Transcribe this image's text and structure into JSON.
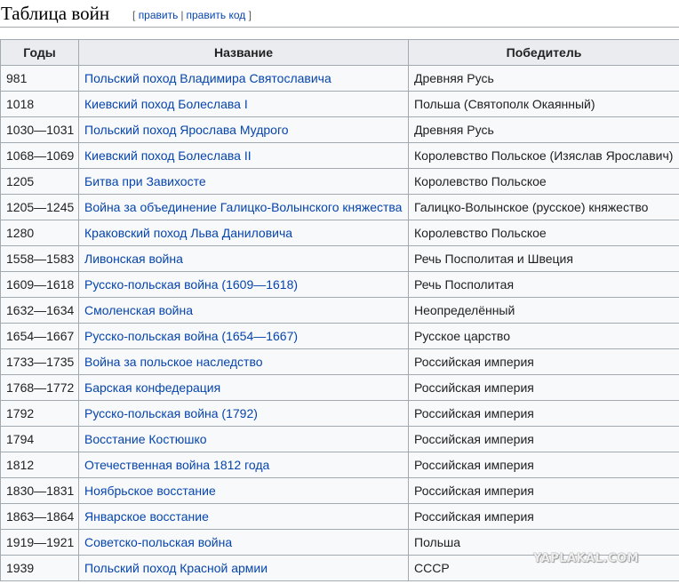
{
  "heading": {
    "title": "Таблица войн",
    "open_bracket": "[",
    "edit_label": "править",
    "separator": "|",
    "edit_code_label": "править код",
    "close_bracket": "]"
  },
  "table": {
    "columns": [
      "Годы",
      "Название",
      "Победитель"
    ],
    "rows": [
      {
        "years": "981",
        "name": "Польский поход Владимира Святославича",
        "winner": "Древняя Русь"
      },
      {
        "years": "1018",
        "name": "Киевский поход Болеслава I",
        "winner": "Польша (Святополк Окаянный)"
      },
      {
        "years": "1030—1031",
        "name": "Польский поход Ярослава Мудрого",
        "winner": "Древняя Русь"
      },
      {
        "years": "1068—1069",
        "name": "Киевский поход Болеслава II",
        "winner": "Королевство Польское (Изяслав Ярославич)"
      },
      {
        "years": "1205",
        "name": "Битва при Завихосте",
        "winner": "Королевство Польское"
      },
      {
        "years": "1205—1245",
        "name": "Война за объединение Галицко-Волынского княжества",
        "winner": "Галицко-Волынское (русское) княжество"
      },
      {
        "years": "1280",
        "name": "Краковский поход Льва Даниловича",
        "winner": "Королевство Польское"
      },
      {
        "years": "1558—1583",
        "name": "Ливонская война",
        "winner": "Речь Посполитая и Швеция"
      },
      {
        "years": "1609—1618",
        "name": "Русско-польская война (1609—1618)",
        "winner": "Речь Посполитая"
      },
      {
        "years": "1632—1634",
        "name": "Смоленская война",
        "winner": "Неопределённый"
      },
      {
        "years": "1654—1667",
        "name": "Русско-польская война (1654—1667)",
        "winner": "Русское царство"
      },
      {
        "years": "1733—1735",
        "name": "Война за польское наследство",
        "winner": "Российская империя"
      },
      {
        "years": "1768—1772",
        "name": "Барская конфедерация",
        "winner": "Российская империя"
      },
      {
        "years": "1792",
        "name": "Русско-польская война (1792)",
        "winner": "Российская империя"
      },
      {
        "years": "1794",
        "name": "Восстание Костюшко",
        "winner": "Российская империя"
      },
      {
        "years": "1812",
        "name": "Отечественная война 1812 года",
        "winner": "Российская империя"
      },
      {
        "years": "1830—1831",
        "name": "Ноябрьское восстание",
        "winner": "Российская империя"
      },
      {
        "years": "1863—1864",
        "name": "Январское восстание",
        "winner": "Российская империя"
      },
      {
        "years": "1919—1921",
        "name": "Советско-польская война",
        "winner": "Польша"
      },
      {
        "years": "1939",
        "name": "Польский поход Красной армии",
        "winner": "СССР"
      }
    ]
  },
  "watermark": "YAPLAKAL.COM",
  "colors": {
    "link": "#0645ad",
    "border": "#a2a9b1",
    "header_bg": "#eaecf0",
    "cell_bg": "#f8f9fa",
    "text": "#202122"
  }
}
